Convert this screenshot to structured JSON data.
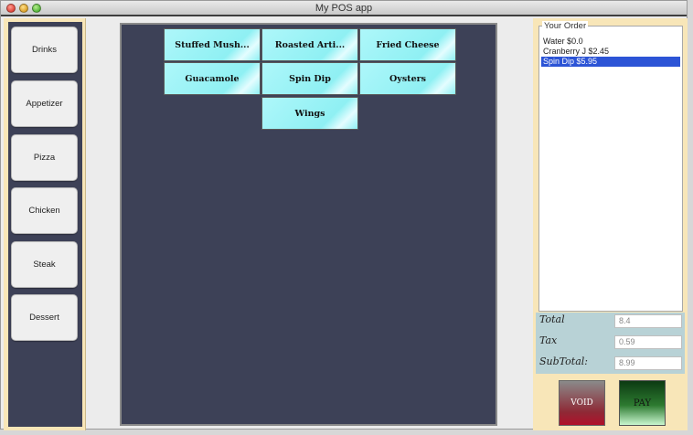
{
  "window": {
    "title": "My POS app"
  },
  "categories": [
    "Drinks",
    "Appetizer",
    "Pizza",
    "Chicken",
    "Steak",
    "Dessert"
  ],
  "menu_items": [
    "Stuffed Mush...",
    "Roasted Arti...",
    "Fried Cheese",
    "Guacamole",
    "Spin Dip",
    "Oysters",
    "Wings"
  ],
  "order": {
    "legend": "Your Order",
    "items": [
      {
        "label": "Water  $0.0",
        "selected": false
      },
      {
        "label": "Cranberry J  $2.45",
        "selected": false
      },
      {
        "label": "Spin Dip  $5.95",
        "selected": true
      }
    ]
  },
  "totals": {
    "total_label": "Total",
    "total_value": "8.4",
    "tax_label": "Tax",
    "tax_value": "0.59",
    "subtotal_label": "SubTotal:",
    "subtotal_value": "8.99"
  },
  "actions": {
    "void_label": "VOID",
    "pay_label": "PAY"
  }
}
